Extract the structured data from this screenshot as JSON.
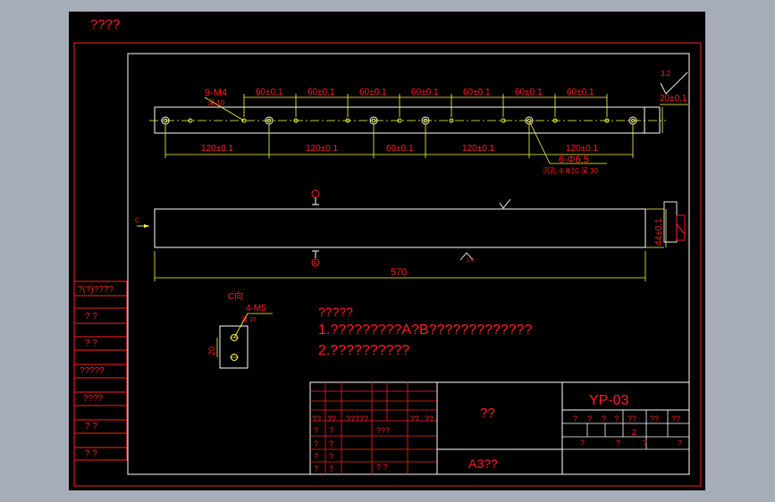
{
  "colors": {
    "background": "#a6adb8",
    "sheet": "#000000",
    "red": "#ff2020",
    "yellow": "#ffff40",
    "white": "#ffffff"
  },
  "header": {
    "title": "????"
  },
  "left_panel": {
    "labels": [
      "?(?)????",
      "?    ?",
      "?    ?",
      "?????",
      "????",
      "?    ?",
      "?    ?"
    ]
  },
  "top_view": {
    "thread_label": "9-M4",
    "thread_depth": "深 10",
    "pitch_top": [
      "60±0.1",
      "60±0.1",
      "60±0.1",
      "60±0.1",
      "60±0.1",
      "60±0.1",
      "60±0.1"
    ],
    "pitch_bottom": [
      "120±0.1",
      "120±0.1",
      "60±0.1",
      "120±0.1",
      "120±0.1"
    ],
    "end_width": "20±0.1",
    "hole_label": "6-Φ6.5",
    "counterbore_label": "沉孔 4-Φ10 深 30",
    "roughness_top": "3.2"
  },
  "front_view": {
    "height": "44±0.1",
    "length": "570",
    "datum_a": "A",
    "roughness": "1.6",
    "section_mark": "C"
  },
  "detail_view": {
    "title": "C向",
    "thread_label": "4-M5",
    "thread_depth": "深 15",
    "spacing": "20"
  },
  "notes": {
    "heading": "?????",
    "line1": "1.?????????A?B?????????????",
    "line2": "2.??????????"
  },
  "title_block": {
    "material": "??",
    "drawing_no": "YP-03",
    "paper": "A3??",
    "change_row": [
      "??",
      "??",
      "?????",
      "??",
      "??"
    ],
    "sign_rows": [
      [
        "?",
        "?",
        "???"
      ],
      [
        "?",
        "?",
        ""
      ],
      [
        "?",
        "?",
        "? ?"
      ]
    ],
    "stage_headers": [
      "?",
      "?",
      "?",
      "?",
      "??",
      "??",
      "??"
    ],
    "scale_value": "2",
    "bottom_row": [
      "?",
      "?",
      "?",
      "?"
    ]
  }
}
